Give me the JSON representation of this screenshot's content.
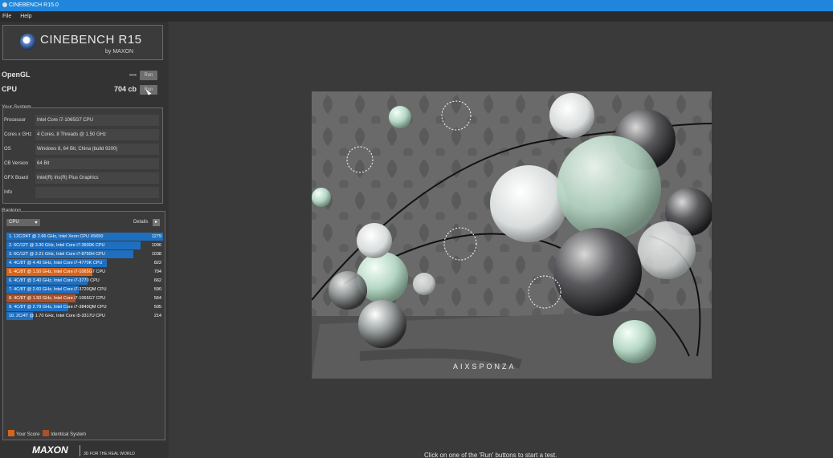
{
  "titlebar": {
    "title": "CINEBENCH R15.0"
  },
  "menu": [
    "File",
    "Help"
  ],
  "logo": {
    "title": "CINEBENCH R15",
    "subtitle": "by MAXON"
  },
  "tests": {
    "opengl": {
      "label": "OpenGL",
      "value": "---",
      "run_label": "Run"
    },
    "cpu": {
      "label": "CPU",
      "value": "704 cb",
      "run_label": "Run"
    }
  },
  "your_system": {
    "label": "Your System",
    "rows": [
      {
        "key": "Processor",
        "value": "Intel Core i7-1065G7 CPU"
      },
      {
        "key": "Cores x GHz",
        "value": "4 Cores, 8 Threads @ 1.50 GHz"
      },
      {
        "key": "OS",
        "value": "Windows 8, 64 Bit, China (build 9200)"
      },
      {
        "key": "CB Version",
        "value": "64 Bit"
      },
      {
        "key": "GFX Board",
        "value": "Intel(R) Iris(R) Plus Graphics"
      },
      {
        "key": "Info",
        "value": ""
      }
    ]
  },
  "ranking": {
    "label": "Ranking",
    "selected": "CPU",
    "details_label": "Details",
    "rows": [
      {
        "label": "1. 12C/24T @ 2.66 GHz, Intel Xeon CPU X5650",
        "score": 1279,
        "type": "other"
      },
      {
        "label": "2. 6C/12T @ 3.30 GHz,  Intel Core i7-3930K CPU",
        "score": 1096,
        "type": "other"
      },
      {
        "label": "3. 6C/12T @ 2.21 GHz, Intel Core i7-8750H CPU",
        "score": 1038,
        "type": "other"
      },
      {
        "label": "4. 4C/8T @ 4.40 GHz, Intel Core i7-4770K CPU",
        "score": 822,
        "type": "other"
      },
      {
        "label": "5. 4C/8T @ 1.50 GHz, Intel Core i7-1065G7 CPU",
        "score": 704,
        "type": "yours"
      },
      {
        "label": "6. 4C/8T @ 3.40 GHz,  Intel Core i7-3770 CPU",
        "score": 662,
        "type": "other"
      },
      {
        "label": "7. 4C/8T @ 2.60 GHz, Intel Core i7-3720QM CPU",
        "score": 590,
        "type": "other"
      },
      {
        "label": "8. 4C/8T @ 1.50 GHz, Intel Core i7-1065G7 CPU",
        "score": 564,
        "type": "identical"
      },
      {
        "label": "9. 4C/8T @ 2.79 GHz, Intel Core i7-3840QM CPU",
        "score": 505,
        "type": "other"
      },
      {
        "label": "10. 2C/4T @ 1.70 GHz,  Intel Core i5-3317U CPU",
        "score": 214,
        "type": "other"
      }
    ],
    "legend": {
      "your_score": "Your Score",
      "identical": "Identical System"
    }
  },
  "colors": {
    "other": "#1f6fc0",
    "yours": "#d7641a",
    "identical": "#a9512a",
    "titlebar": "#1f86dc"
  },
  "footer": {
    "brand": "MAXON",
    "tagline": "3D FOR THE REAL WORLD"
  },
  "render": {
    "watermark": "AIXSPONZA"
  },
  "status": "Click on one of the 'Run' buttons to start a test."
}
